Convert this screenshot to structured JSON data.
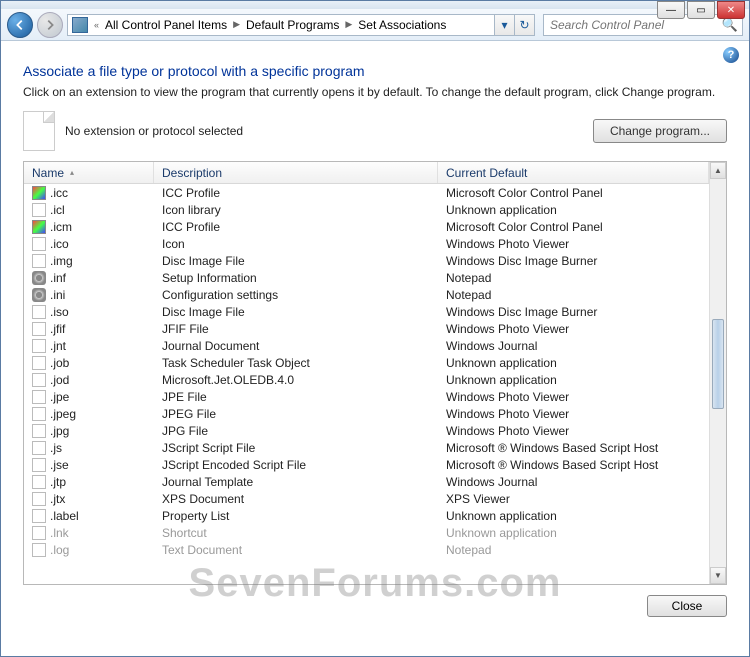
{
  "window": {
    "min_tip": "Minimize",
    "max_tip": "Maximize",
    "close_tip": "Close"
  },
  "nav": {
    "breadcrumb_prefix": "«",
    "crumbs": [
      "All Control Panel Items",
      "Default Programs",
      "Set Associations"
    ],
    "search_placeholder": "Search Control Panel"
  },
  "page": {
    "title": "Associate a file type or protocol with a specific program",
    "desc": "Click on an extension to view the program that currently opens it by default. To change the default program, click Change program.",
    "no_selection": "No extension or protocol selected",
    "change_btn": "Change program...",
    "close_btn": "Close",
    "help_tip": "Help"
  },
  "columns": {
    "name": "Name",
    "desc": "Description",
    "def": "Current Default"
  },
  "rows": [
    {
      "ext": ".icc",
      "icon": "color",
      "desc": "ICC Profile",
      "def": "Microsoft Color Control Panel"
    },
    {
      "ext": ".icl",
      "icon": "doc",
      "desc": "Icon library",
      "def": "Unknown application"
    },
    {
      "ext": ".icm",
      "icon": "color",
      "desc": "ICC Profile",
      "def": "Microsoft Color Control Panel"
    },
    {
      "ext": ".ico",
      "icon": "doc",
      "desc": "Icon",
      "def": "Windows Photo Viewer"
    },
    {
      "ext": ".img",
      "icon": "doc",
      "desc": "Disc Image File",
      "def": "Windows Disc Image Burner"
    },
    {
      "ext": ".inf",
      "icon": "gear",
      "desc": "Setup Information",
      "def": "Notepad"
    },
    {
      "ext": ".ini",
      "icon": "gear",
      "desc": "Configuration settings",
      "def": "Notepad"
    },
    {
      "ext": ".iso",
      "icon": "doc",
      "desc": "Disc Image File",
      "def": "Windows Disc Image Burner"
    },
    {
      "ext": ".jfif",
      "icon": "doc",
      "desc": "JFIF File",
      "def": "Windows Photo Viewer"
    },
    {
      "ext": ".jnt",
      "icon": "doc",
      "desc": "Journal Document",
      "def": "Windows Journal"
    },
    {
      "ext": ".job",
      "icon": "doc",
      "desc": "Task Scheduler Task Object",
      "def": "Unknown application"
    },
    {
      "ext": ".jod",
      "icon": "doc",
      "desc": "Microsoft.Jet.OLEDB.4.0",
      "def": "Unknown application"
    },
    {
      "ext": ".jpe",
      "icon": "doc",
      "desc": "JPE File",
      "def": "Windows Photo Viewer"
    },
    {
      "ext": ".jpeg",
      "icon": "doc",
      "desc": "JPEG File",
      "def": "Windows Photo Viewer"
    },
    {
      "ext": ".jpg",
      "icon": "doc",
      "desc": "JPG File",
      "def": "Windows Photo Viewer"
    },
    {
      "ext": ".js",
      "icon": "doc",
      "desc": "JScript Script File",
      "def": "Microsoft ® Windows Based Script Host"
    },
    {
      "ext": ".jse",
      "icon": "doc",
      "desc": "JScript Encoded Script File",
      "def": "Microsoft ® Windows Based Script Host"
    },
    {
      "ext": ".jtp",
      "icon": "doc",
      "desc": "Journal Template",
      "def": "Windows Journal"
    },
    {
      "ext": ".jtx",
      "icon": "doc",
      "desc": "XPS Document",
      "def": "XPS Viewer"
    },
    {
      "ext": ".label",
      "icon": "doc",
      "desc": "Property List",
      "def": "Unknown application"
    },
    {
      "ext": ".lnk",
      "icon": "doc",
      "desc": "Shortcut",
      "def": "Unknown application",
      "dim": true
    },
    {
      "ext": ".log",
      "icon": "doc",
      "desc": "Text Document",
      "def": "Notepad",
      "dim": true
    }
  ],
  "watermark": "SevenForums.com"
}
